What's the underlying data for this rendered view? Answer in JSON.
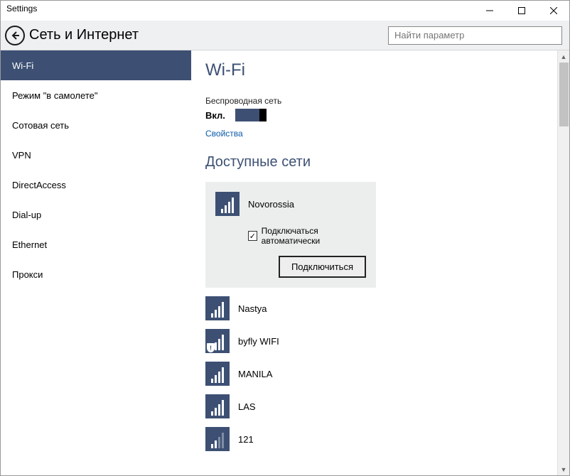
{
  "window": {
    "title": "Settings"
  },
  "header": {
    "page_title": "Сеть и Интернет"
  },
  "search": {
    "placeholder": "Найти параметр"
  },
  "sidebar": {
    "items": [
      {
        "label": "Wi-Fi",
        "selected": true
      },
      {
        "label": "Режим \"в самолете\""
      },
      {
        "label": "Сотовая сеть"
      },
      {
        "label": "VPN"
      },
      {
        "label": "DirectAccess"
      },
      {
        "label": "Dial-up"
      },
      {
        "label": "Ethernet"
      },
      {
        "label": "Прокси"
      }
    ]
  },
  "content": {
    "heading": "Wi-Fi",
    "wireless_label": "Беспроводная сеть",
    "toggle_state": "Вкл.",
    "properties_link": "Свойства",
    "available_heading": "Доступные сети",
    "auto_connect_label": "Подключаться автоматически",
    "connect_button": "Подключиться"
  },
  "networks": [
    {
      "name": "Novorossia",
      "signal": 4,
      "selected": true,
      "auto_checked": true,
      "secured": false
    },
    {
      "name": "Nastya",
      "signal": 4,
      "secured": false
    },
    {
      "name": "byfly WIFI",
      "signal": 4,
      "secured": true
    },
    {
      "name": "MANILA",
      "signal": 4,
      "secured": false
    },
    {
      "name": "LAS",
      "signal": 4,
      "secured": false
    },
    {
      "name": "121",
      "signal": 2,
      "secured": false
    }
  ]
}
